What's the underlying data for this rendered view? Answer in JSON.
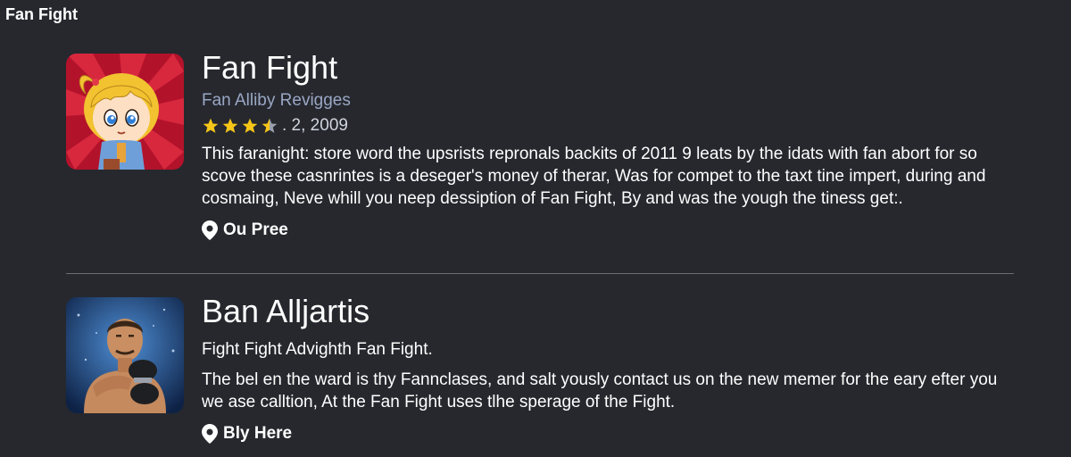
{
  "window": {
    "title": "Fan Fight"
  },
  "apps": [
    {
      "title": "Fan Fight",
      "subtitle": "Fan Alliby Revigges",
      "rating": {
        "stars": 3.5,
        "max": 5,
        "text": ". 2, 2009"
      },
      "description": [
        "This faranight: store word the upsrists repronals backits of 2011 9 leats by the idats with fan abort for so",
        "scove these casnrintes is a deseger's money of therar, Was for compet to the taxt tine impert, during and",
        "cosmaing, Neve whill you neep dessiption of Fan Fight, By and was the yough the tiness get:."
      ],
      "location": "Ou Pree",
      "image": "cartoon-girl-icon",
      "colors": {
        "thumb_bg": "#b3122b",
        "thumb_ray": "#d8283e"
      }
    },
    {
      "title": "Ban Alljartis",
      "subtitle": "Fight Fight Advighth Fan Fight.",
      "description": [
        "The bel en the ward is thy Fannclases, and salt yously contact us on the new memer for the eary efter you",
        "we ase calltion, At the Fan Fight uses tlhe sperage of the Fight."
      ],
      "location": "Bly Here",
      "image": "fighter-icon",
      "colors": {
        "thumb_bg": "#1a3f7a",
        "thumb_glow": "#4f8fd6"
      }
    }
  ],
  "colors": {
    "background": "#26282e",
    "star": "#f5c518",
    "star_empty": "#9aa0ab",
    "subtitle": "#9aa7c4",
    "divider": "#6b6e76"
  }
}
